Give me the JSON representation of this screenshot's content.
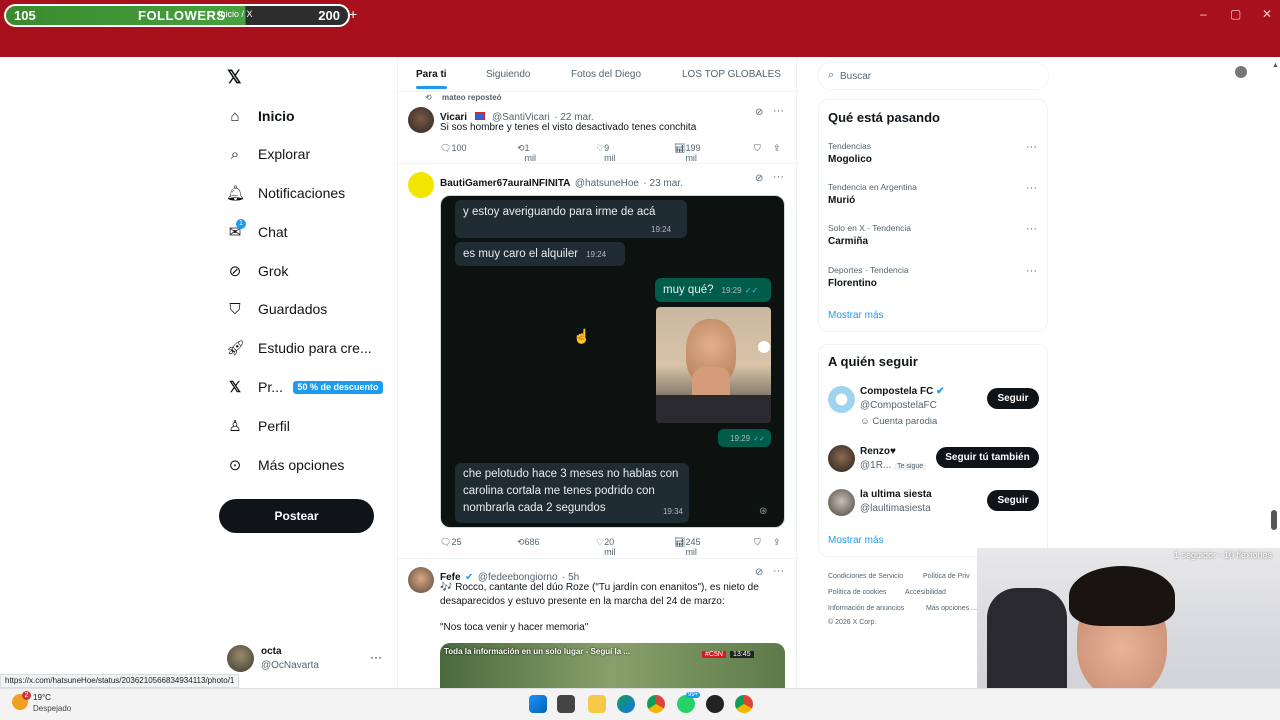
{
  "browser": {
    "overlay": {
      "left_count": "105",
      "label": "FOLLOWERS",
      "right_count": "200"
    },
    "tab_title": "Inicio / X",
    "url": "x.com/home",
    "status_url": "https://x.com/hatsuneHoe/status/2036210566834934113/photo/1"
  },
  "nav": {
    "items": [
      {
        "label": "Inicio",
        "icon": "home-icon"
      },
      {
        "label": "Explorar",
        "icon": "search-icon"
      },
      {
        "label": "Notificaciones",
        "icon": "bell-icon"
      },
      {
        "label": "Chat",
        "icon": "mail-icon",
        "badge": "1"
      },
      {
        "label": "Grok",
        "icon": "grok-icon"
      },
      {
        "label": "Guardados",
        "icon": "bookmark-icon"
      },
      {
        "label": "Estudio para cre...",
        "icon": "rocket-icon"
      },
      {
        "label": "Pr...",
        "icon": "x-logo-icon"
      },
      {
        "label": "Perfil",
        "icon": "person-icon"
      },
      {
        "label": "Más opciones",
        "icon": "more-circle-icon"
      }
    ],
    "premium_badge": "50 % de descuento",
    "post_button": "Postear",
    "profile": {
      "name": "octa",
      "handle": "@OcNavarta"
    }
  },
  "timeline": {
    "tabs": [
      "Para ti",
      "Siguiendo",
      "Fotos del Diego",
      "LOS TOP GLOBALES"
    ],
    "repost_label": "mateo reposteó",
    "posts": [
      {
        "name": "Vicari",
        "handle": "@SantiVicari",
        "date": "· 22 mar.",
        "text": "Si sos hombre y tenes el visto desactivado tenes conchita",
        "replies": "100",
        "reposts": "1 mil",
        "likes": "9 mil",
        "views": "199 mil"
      },
      {
        "name": "BautiGamer67auraINFINITA",
        "handle": "@hatsuneHoe",
        "date": "· 23 mar.",
        "chat": [
          {
            "text": "y estoy averiguando para irme de acá",
            "time": "19:24"
          },
          {
            "text": "es muy caro el alquiler",
            "time": "19:24"
          },
          {
            "text": "muy qué?",
            "time": "19:29"
          },
          {
            "text": "",
            "time": "19:29"
          },
          {
            "text": "che pelotudo hace 3 meses no hablas con carolina cortala me tenes podrido con nombrarla cada 2 segundos",
            "time": "19:34"
          }
        ],
        "replies": "25",
        "reposts": "686",
        "likes": "20 mil",
        "views": "245 mil"
      },
      {
        "name": "Fefe",
        "handle": "@fedeebongiorno",
        "date": "· 5h",
        "text": "🎶 Rocco, cantante del dúo Roze (\"Tu jardín con enanitos\"), es nieto de desaparecidos y estuvo presente en la marcha del 24 de marzo:",
        "quote": "\"Nos toca venir y hacer memoria\"",
        "media_caption": "Toda la información en un solo lugar - Seguí la ...",
        "media_badge": "#C5N",
        "media_time": "13:45"
      }
    ]
  },
  "sidebar": {
    "search_placeholder": "Buscar",
    "trends_title": "Qué está pasando",
    "trends": [
      {
        "meta": "Tendencias",
        "name": "Mogolico"
      },
      {
        "meta": "Tendencia en Argentina",
        "name": "Murió"
      },
      {
        "meta": "Solo en X · Tendencia",
        "name": "Carmiña"
      },
      {
        "meta": "Deportes · Tendencia",
        "name": "Florentino"
      }
    ],
    "show_more": "Mostrar más",
    "who_title": "A quién seguir",
    "who": [
      {
        "name": "Compostela FC",
        "handle": "@CompostelaFC",
        "extra": "Cuenta parodia",
        "button": "Seguir"
      },
      {
        "name": "Renzo♥",
        "handle": "@1R...",
        "extra": "Te sigue",
        "button": "Seguir tú también"
      },
      {
        "name": "la ultima siesta",
        "handle": "@laultimasiesta",
        "extra": "",
        "button": "Seguir"
      }
    ],
    "who_more": "Mostrar más",
    "footer": [
      "Condiciones de Servicio",
      "Política de Priv",
      "Política de cookies",
      "Accesibilidad",
      "Información de anuncios",
      "Más opciones ...",
      "© 2026 X Corp."
    ]
  },
  "webcam": {
    "overlay_text": "1 seguidor - 10 flexiones"
  },
  "taskbar": {
    "weather_temp": "19°C",
    "weather_desc": "Despejado",
    "badge": "99+"
  }
}
